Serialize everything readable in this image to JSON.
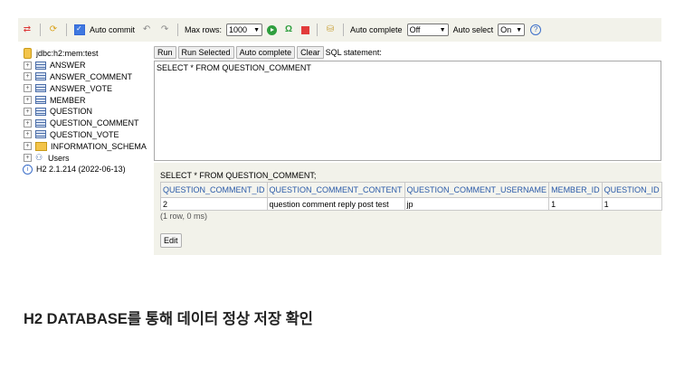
{
  "toolbar": {
    "auto_commit_label": "Auto commit",
    "max_rows_label": "Max rows:",
    "max_rows_value": "1000",
    "auto_complete_label": "Auto complete",
    "auto_complete_value": "Off",
    "auto_select_label": "Auto select",
    "auto_select_value": "On"
  },
  "sidebar": {
    "connection": "jdbc:h2:mem:test",
    "tables": [
      "ANSWER",
      "ANSWER_COMMENT",
      "ANSWER_VOTE",
      "MEMBER",
      "QUESTION",
      "QUESTION_COMMENT",
      "QUESTION_VOTE"
    ],
    "schema": "INFORMATION_SCHEMA",
    "users": "Users",
    "version": "H2 2.1.214 (2022-06-13)"
  },
  "query_bar": {
    "run": "Run",
    "run_selected": "Run Selected",
    "auto_complete": "Auto complete",
    "clear": "Clear",
    "sql_statement_label": "SQL statement:"
  },
  "editor": {
    "text": "SELECT * FROM QUESTION_COMMENT"
  },
  "results": {
    "executed_sql": "SELECT * FROM QUESTION_COMMENT;",
    "columns": [
      "QUESTION_COMMENT_ID",
      "QUESTION_COMMENT_CONTENT",
      "QUESTION_COMMENT_USERNAME",
      "MEMBER_ID",
      "QUESTION_ID"
    ],
    "rows": [
      [
        "2",
        "question comment reply post test",
        "jp",
        "1",
        "1"
      ]
    ],
    "row_count": "(1 row, 0 ms)",
    "edit_button": "Edit"
  },
  "caption": "H2 DATABASE를 통해 데이터 정상 저장 확인",
  "colors": {
    "toolbar_bg": "#f2f2ea",
    "header_text": "#2a5aa8",
    "run_green": "#2e9e3e",
    "stop_red": "#e23b3b"
  }
}
